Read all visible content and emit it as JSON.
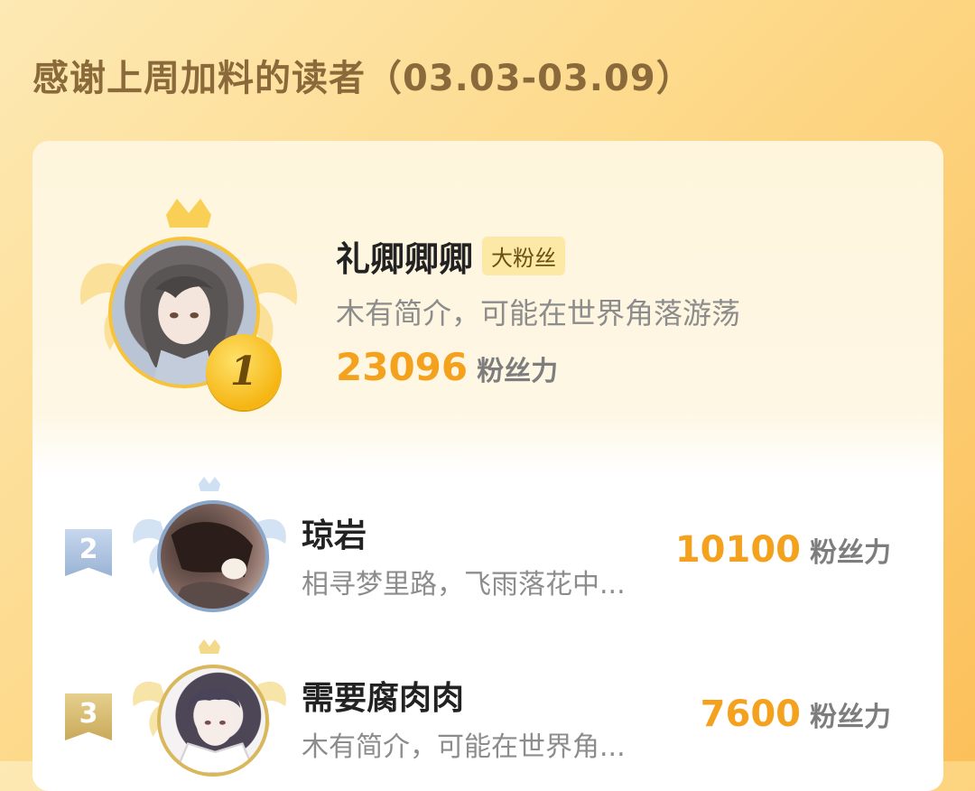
{
  "header": {
    "title": "感谢上周加料的读者（03.03-03.09）"
  },
  "top_reader": {
    "rank": "1",
    "name": "礼卿卿卿",
    "tag": "大粉丝",
    "bio": "木有简介，可能在世界角落游荡",
    "score": "23096",
    "score_label": "粉丝力"
  },
  "readers": [
    {
      "rank": "2",
      "name": "琼岩",
      "bio": "相寻梦里路，飞雨落花中...",
      "score": "10100",
      "score_label": "粉丝力"
    },
    {
      "rank": "3",
      "name": "需要腐肉肉",
      "bio": "木有简介，可能在世界角...",
      "score": "7600",
      "score_label": "粉丝力"
    }
  ],
  "colors": {
    "accent_score": "#f4a11e",
    "gold": "#f6c33a",
    "silver": "#8ca6c8",
    "bronze": "#d9b75c"
  },
  "icons": [
    "crown-icon",
    "wing-frame-icon",
    "rank-medal-icon",
    "rank-ribbon-icon"
  ]
}
